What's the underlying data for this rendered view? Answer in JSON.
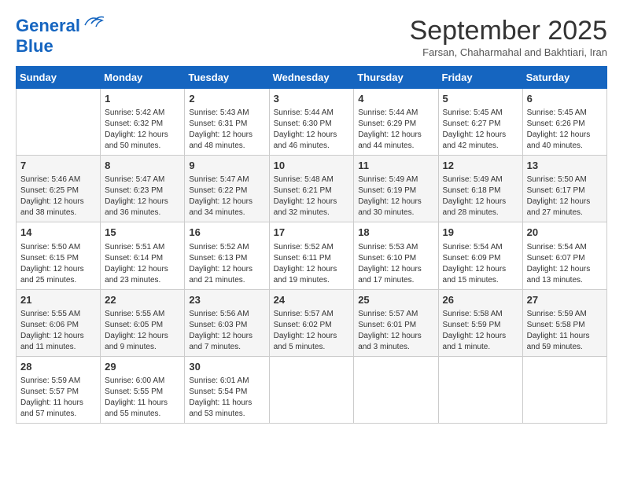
{
  "header": {
    "logo_line1": "General",
    "logo_line2": "Blue",
    "month": "September 2025",
    "location": "Farsan, Chaharmahal and Bakhtiari, Iran"
  },
  "days_of_week": [
    "Sunday",
    "Monday",
    "Tuesday",
    "Wednesday",
    "Thursday",
    "Friday",
    "Saturday"
  ],
  "weeks": [
    [
      {
        "day": "",
        "info": ""
      },
      {
        "day": "1",
        "info": "Sunrise: 5:42 AM\nSunset: 6:32 PM\nDaylight: 12 hours\nand 50 minutes."
      },
      {
        "day": "2",
        "info": "Sunrise: 5:43 AM\nSunset: 6:31 PM\nDaylight: 12 hours\nand 48 minutes."
      },
      {
        "day": "3",
        "info": "Sunrise: 5:44 AM\nSunset: 6:30 PM\nDaylight: 12 hours\nand 46 minutes."
      },
      {
        "day": "4",
        "info": "Sunrise: 5:44 AM\nSunset: 6:29 PM\nDaylight: 12 hours\nand 44 minutes."
      },
      {
        "day": "5",
        "info": "Sunrise: 5:45 AM\nSunset: 6:27 PM\nDaylight: 12 hours\nand 42 minutes."
      },
      {
        "day": "6",
        "info": "Sunrise: 5:45 AM\nSunset: 6:26 PM\nDaylight: 12 hours\nand 40 minutes."
      }
    ],
    [
      {
        "day": "7",
        "info": "Sunrise: 5:46 AM\nSunset: 6:25 PM\nDaylight: 12 hours\nand 38 minutes."
      },
      {
        "day": "8",
        "info": "Sunrise: 5:47 AM\nSunset: 6:23 PM\nDaylight: 12 hours\nand 36 minutes."
      },
      {
        "day": "9",
        "info": "Sunrise: 5:47 AM\nSunset: 6:22 PM\nDaylight: 12 hours\nand 34 minutes."
      },
      {
        "day": "10",
        "info": "Sunrise: 5:48 AM\nSunset: 6:21 PM\nDaylight: 12 hours\nand 32 minutes."
      },
      {
        "day": "11",
        "info": "Sunrise: 5:49 AM\nSunset: 6:19 PM\nDaylight: 12 hours\nand 30 minutes."
      },
      {
        "day": "12",
        "info": "Sunrise: 5:49 AM\nSunset: 6:18 PM\nDaylight: 12 hours\nand 28 minutes."
      },
      {
        "day": "13",
        "info": "Sunrise: 5:50 AM\nSunset: 6:17 PM\nDaylight: 12 hours\nand 27 minutes."
      }
    ],
    [
      {
        "day": "14",
        "info": "Sunrise: 5:50 AM\nSunset: 6:15 PM\nDaylight: 12 hours\nand 25 minutes."
      },
      {
        "day": "15",
        "info": "Sunrise: 5:51 AM\nSunset: 6:14 PM\nDaylight: 12 hours\nand 23 minutes."
      },
      {
        "day": "16",
        "info": "Sunrise: 5:52 AM\nSunset: 6:13 PM\nDaylight: 12 hours\nand 21 minutes."
      },
      {
        "day": "17",
        "info": "Sunrise: 5:52 AM\nSunset: 6:11 PM\nDaylight: 12 hours\nand 19 minutes."
      },
      {
        "day": "18",
        "info": "Sunrise: 5:53 AM\nSunset: 6:10 PM\nDaylight: 12 hours\nand 17 minutes."
      },
      {
        "day": "19",
        "info": "Sunrise: 5:54 AM\nSunset: 6:09 PM\nDaylight: 12 hours\nand 15 minutes."
      },
      {
        "day": "20",
        "info": "Sunrise: 5:54 AM\nSunset: 6:07 PM\nDaylight: 12 hours\nand 13 minutes."
      }
    ],
    [
      {
        "day": "21",
        "info": "Sunrise: 5:55 AM\nSunset: 6:06 PM\nDaylight: 12 hours\nand 11 minutes."
      },
      {
        "day": "22",
        "info": "Sunrise: 5:55 AM\nSunset: 6:05 PM\nDaylight: 12 hours\nand 9 minutes."
      },
      {
        "day": "23",
        "info": "Sunrise: 5:56 AM\nSunset: 6:03 PM\nDaylight: 12 hours\nand 7 minutes."
      },
      {
        "day": "24",
        "info": "Sunrise: 5:57 AM\nSunset: 6:02 PM\nDaylight: 12 hours\nand 5 minutes."
      },
      {
        "day": "25",
        "info": "Sunrise: 5:57 AM\nSunset: 6:01 PM\nDaylight: 12 hours\nand 3 minutes."
      },
      {
        "day": "26",
        "info": "Sunrise: 5:58 AM\nSunset: 5:59 PM\nDaylight: 12 hours\nand 1 minute."
      },
      {
        "day": "27",
        "info": "Sunrise: 5:59 AM\nSunset: 5:58 PM\nDaylight: 11 hours\nand 59 minutes."
      }
    ],
    [
      {
        "day": "28",
        "info": "Sunrise: 5:59 AM\nSunset: 5:57 PM\nDaylight: 11 hours\nand 57 minutes."
      },
      {
        "day": "29",
        "info": "Sunrise: 6:00 AM\nSunset: 5:55 PM\nDaylight: 11 hours\nand 55 minutes."
      },
      {
        "day": "30",
        "info": "Sunrise: 6:01 AM\nSunset: 5:54 PM\nDaylight: 11 hours\nand 53 minutes."
      },
      {
        "day": "",
        "info": ""
      },
      {
        "day": "",
        "info": ""
      },
      {
        "day": "",
        "info": ""
      },
      {
        "day": "",
        "info": ""
      }
    ]
  ]
}
